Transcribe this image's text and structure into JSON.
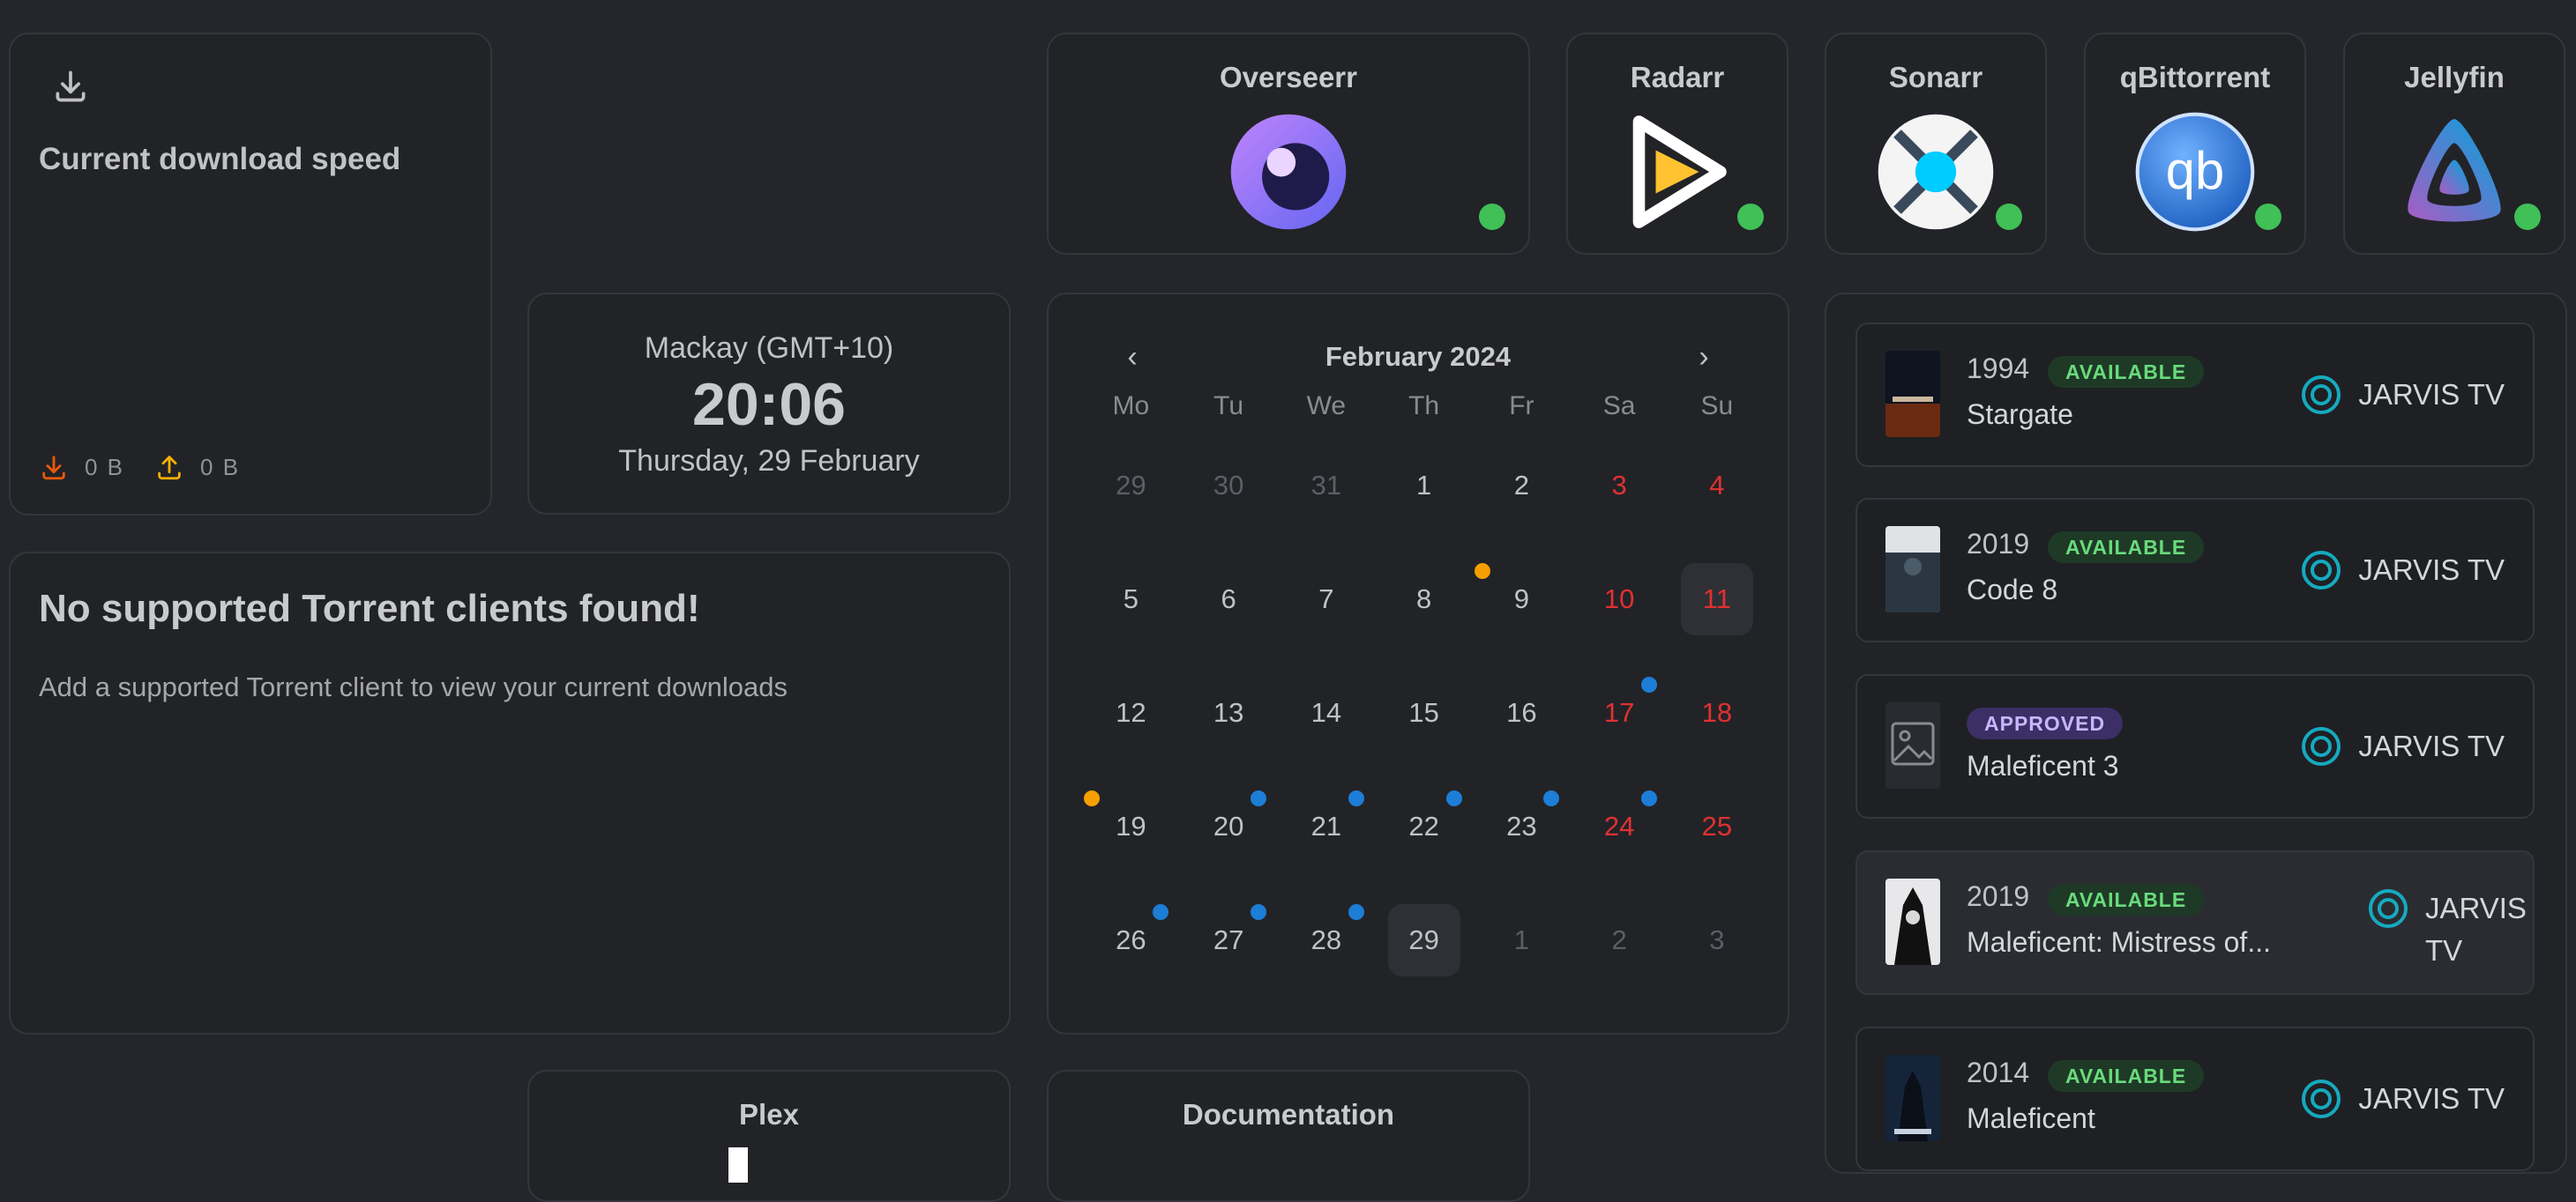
{
  "download_widget": {
    "title": "Current download speed",
    "download": "0 B",
    "upload": "0 B"
  },
  "clock": {
    "location": "Mackay (GMT+10)",
    "time": "20:06",
    "date": "Thursday, 29 February"
  },
  "torrent_widget": {
    "title": "No supported Torrent clients found!",
    "message": "Add a supported Torrent client to view your current downloads"
  },
  "apps": [
    {
      "name": "Overseerr",
      "icon": "overseerr-icon",
      "status": "online"
    },
    {
      "name": "Radarr",
      "icon": "radarr-icon",
      "status": "online"
    },
    {
      "name": "Sonarr",
      "icon": "sonarr-icon",
      "status": "online"
    },
    {
      "name": "qBittorrent",
      "icon": "qbittorrent-icon",
      "status": "online"
    },
    {
      "name": "Jellyfin",
      "icon": "jellyfin-icon",
      "status": "online"
    }
  ],
  "bottom_apps": [
    {
      "name": "Plex"
    },
    {
      "name": "Documentation"
    }
  ],
  "calendar": {
    "title": "February 2024",
    "weekdays": [
      "Mo",
      "Tu",
      "We",
      "Th",
      "Fr",
      "Sa",
      "Su"
    ],
    "weeks": [
      [
        "29",
        "30",
        "31",
        "1",
        "2",
        "3",
        "4"
      ],
      [
        "5",
        "6",
        "7",
        "8",
        "9",
        "10",
        "11"
      ],
      [
        "12",
        "13",
        "14",
        "15",
        "16",
        "17",
        "18"
      ],
      [
        "19",
        "20",
        "21",
        "22",
        "23",
        "24",
        "25"
      ],
      [
        "26",
        "27",
        "28",
        "29",
        "1",
        "2",
        "3"
      ]
    ],
    "selected_days": [
      "11",
      "29"
    ],
    "release_markers": {
      "orange": [
        "9",
        "19"
      ],
      "blue": [
        "17",
        "20",
        "21",
        "22",
        "23",
        "24",
        "26",
        "27",
        "28"
      ]
    }
  },
  "requests": [
    {
      "year": "1994",
      "status": "AVAILABLE",
      "title": "Stargate",
      "server": "JARVIS TV"
    },
    {
      "year": "2019",
      "status": "AVAILABLE",
      "title": "Code 8",
      "server": "JARVIS TV"
    },
    {
      "year": "",
      "status": "APPROVED",
      "title": "Maleficent 3",
      "server": "JARVIS TV"
    },
    {
      "year": "2019",
      "status": "AVAILABLE",
      "title": "Maleficent: Mistress of...",
      "server": "JARVIS TV"
    },
    {
      "year": "2014",
      "status": "AVAILABLE",
      "title": "Maleficent",
      "server": "JARVIS TV"
    }
  ],
  "colors": {
    "background": "#25262b",
    "card": "#222327",
    "online": "#40c057",
    "weekend": "#e03131",
    "available_badge": "#69db7c",
    "approved_badge": "#c8b6ff"
  }
}
